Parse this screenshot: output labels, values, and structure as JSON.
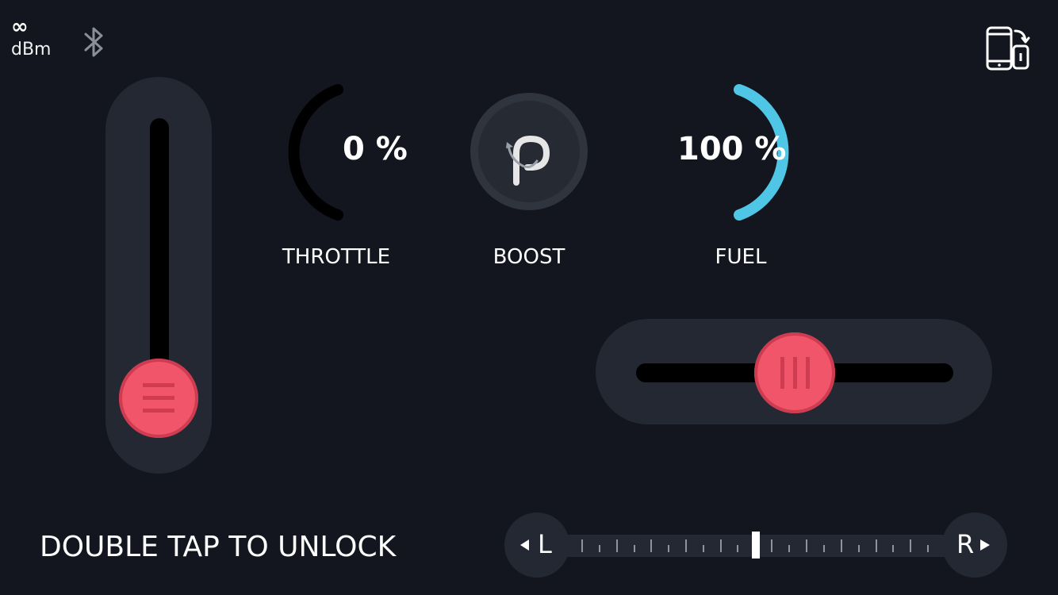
{
  "status": {
    "signal_value": "∞",
    "signal_unit": "dBm",
    "bluetooth_icon": "bluetooth-icon",
    "rotate_icon": "phone-rotate-icon"
  },
  "throttle": {
    "value": "0 %",
    "label": "THROTTLE",
    "level": 0
  },
  "boost": {
    "label": "BOOST",
    "icon": "boost-p-icon"
  },
  "fuel": {
    "value": "100 %",
    "label": "FUEL",
    "level": 1.0
  },
  "vertical_slider": {
    "position": 0
  },
  "horizontal_slider": {
    "position": 0.5
  },
  "lock": {
    "message": "DOUBLE TAP TO UNLOCK"
  },
  "trim": {
    "left_label": "L",
    "right_label": "R",
    "position": 0.5
  },
  "colors": {
    "background": "#13161e",
    "panel": "#242833",
    "knob": "#f0556a",
    "fuel_arc": "#4fc6e6"
  }
}
